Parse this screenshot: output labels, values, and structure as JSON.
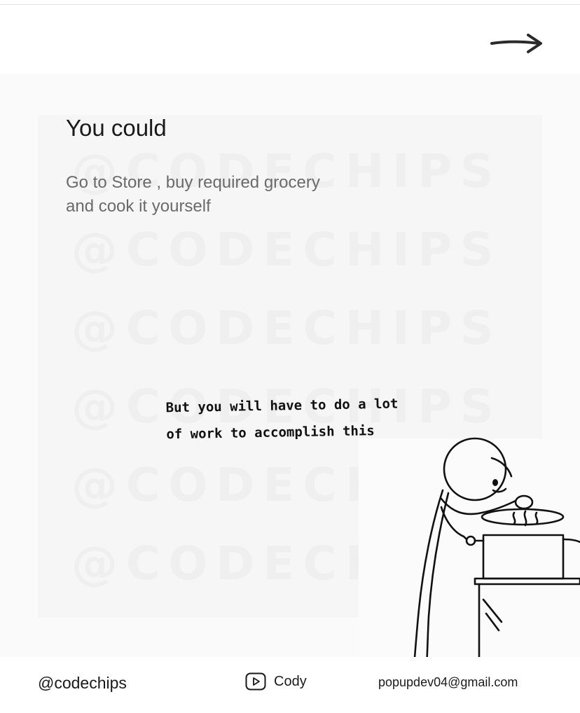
{
  "header": {
    "next_icon": "arrow-right-icon"
  },
  "watermark": {
    "text": "@CODECHIPS"
  },
  "slide": {
    "heading": "You could",
    "body": "Go to Store , buy required grocery and cook it yourself",
    "note_line1": "But you will have to do a lot",
    "note_line2": "of work to accomplish this",
    "illustration": "stick-figure-cooking-illustration"
  },
  "footer": {
    "handle": "@codechips",
    "channel_icon": "play-button-icon",
    "channel": "Cody",
    "email": "popupdev04@gmail.com"
  }
}
